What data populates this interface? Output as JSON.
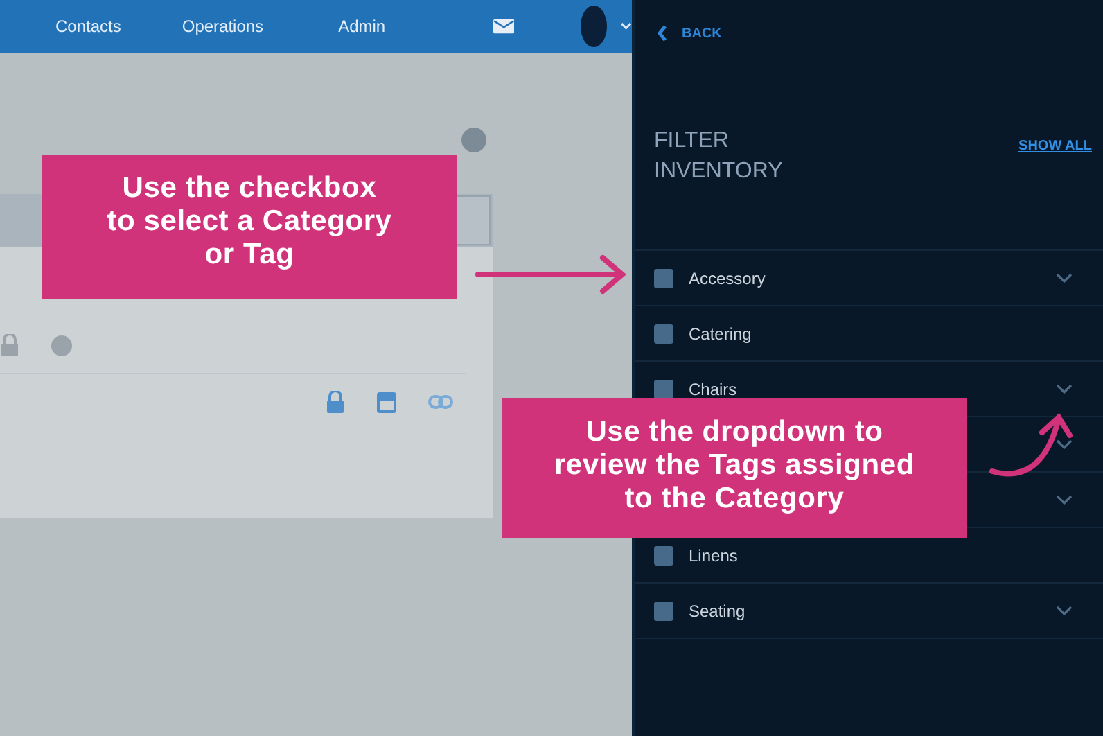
{
  "app": {
    "nav": [
      "Contacts",
      "Operations",
      "Admin"
    ]
  },
  "filter_panel": {
    "back": "BACK",
    "title": "FILTER INVENTORY",
    "show_all": "SHOW ALL",
    "categories": [
      {
        "label": "Accessory",
        "checked": false,
        "expandable": true
      },
      {
        "label": "Catering",
        "checked": false,
        "expandable": false
      },
      {
        "label": "Chairs",
        "checked": false,
        "expandable": true
      },
      {
        "expandable": true
      },
      {
        "expandable": true
      },
      {
        "label": "Linens",
        "checked": false,
        "expandable": false
      },
      {
        "label": "Seating",
        "checked": false,
        "expandable": true
      }
    ]
  },
  "callouts": [
    {
      "lines": [
        "Use the checkbox",
        "to select a Category",
        "or Tag"
      ]
    },
    {
      "lines": [
        "Use the dropdown to",
        "review the Tags assigned",
        "to the Category"
      ]
    }
  ]
}
